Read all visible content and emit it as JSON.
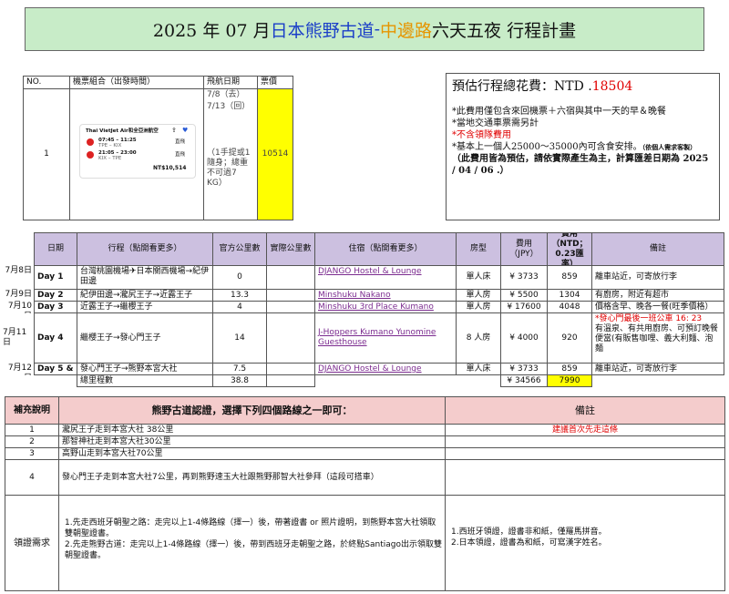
{
  "title": {
    "part1": "2025 年 07 月 ",
    "part2": "日本熊野古道",
    "part3": " - ",
    "part4": "中邊路",
    "part5": " 六天五夜 行程計畫"
  },
  "flight_table": {
    "headers": [
      "NO.",
      "機票組合（出發時間）",
      "飛航日期",
      "票價"
    ],
    "row_no": "1",
    "dates_out": "7/8（去）",
    "dates_back": "7/13（回）",
    "baggage_note": "（1手提或1隨身；總重不可過7 KG）",
    "price": "10514",
    "ticket": {
      "airline": "Thai VietJet Air和全亞洲航空",
      "seg1_time": "07:45 – 11:25",
      "seg1_code": "TPE – KIX",
      "seg1_tag": "直飛",
      "seg2_time": "21:05 – 23:00",
      "seg2_code": "KIX – TPE",
      "seg2_tag": "直飛",
      "total": "NT$10,514"
    }
  },
  "summary": {
    "label": "預估行程總花費：NTD .",
    "amount": "18504",
    "line1": "*此費用僅包含來回機票＋六宿與其中一天的早＆晚餐",
    "line2": "*當地交通車票需另計",
    "line3": "*不含領隊費用",
    "line4": "*基本上一個人25000～35000內可含食安排。",
    "line4_note": "（依個人需求客製）",
    "line5": "（此費用皆為預估，請依實際產生為主，計算匯差日期為 2025 / 04 / 06 .）"
  },
  "itinerary": {
    "headers": [
      "日期",
      "行程（點開看更多）",
      "官方公里數",
      "實際公里數",
      "住宿（點開看更多）",
      "房型",
      "費用（JPY）",
      "費用（NTD；0.23匯率）",
      "備註"
    ],
    "rows": [
      {
        "date": "7月8日",
        "day": "Day 1",
        "route": "台灣桃園機場✈日本關西機場→紀伊田邊",
        "km": "0",
        "real": "",
        "stay": "DJANGO Hostel & Lounge",
        "room": "單人床",
        "jpy": "¥ 3733",
        "ntd": "859",
        "note": "離車站近，可寄放行李",
        "note_red": ""
      },
      {
        "date": "7月9日",
        "day": "Day 2",
        "route": "紀伊田邊→瀧尻王子→近露王子",
        "km": "13.3",
        "real": "",
        "stay": "Minshuku Nakano",
        "room": "單人房",
        "jpy": "¥ 5500",
        "ntd": "1304",
        "note": "有廚房，附近有超市",
        "note_red": ""
      },
      {
        "date": "7月10日",
        "day": "Day 3",
        "route": "近露王子→繼櫻王子",
        "km": "4",
        "real": "",
        "stay": "Minshuku 3rd Place Kumano Kodo",
        "room": "單人房",
        "jpy": "¥ 17600",
        "ntd": "4048",
        "note": "價格含早、晚各一餐(旺季價格）",
        "note_red": ""
      },
      {
        "date": "7月11日",
        "day": "Day 4",
        "route": "繼櫻王子→發心門王子",
        "km": "14",
        "real": "",
        "stay": "J-Hoppers Kumano Yunomine Guesthouse",
        "room": "8 人房",
        "jpy": "¥ 4000",
        "ntd": "920",
        "note": "有溫泉、有共用廚房、可預訂晚餐便當(有販售咖哩、義大利麵、泡麵",
        "note_red": "*發心門最後一班公車 16: 23"
      },
      {
        "date": "7月12日",
        "day": "Day 5 & 6",
        "route": "發心門王子→熊野本宮大社",
        "km": "7.5",
        "real": "",
        "stay": "DJANGO Hostel & Lounge",
        "room": "單人床",
        "jpy": "¥ 3733",
        "ntd": "859",
        "note": "離車站近，可寄放行李",
        "note_red": ""
      }
    ],
    "total_label": "總里程數",
    "total_km": "38.8",
    "total_jpy": "¥ 34566",
    "total_ntd": "7990"
  },
  "cert": {
    "col1": "補充說明",
    "col2": "熊野古道認證，選擇下列四個路線之一即可：",
    "col3": "備註",
    "rows": [
      {
        "no": "1",
        "text": "瀧尻王子走到本宮大社 38公里",
        "note": "建議首次先走這條"
      },
      {
        "no": "2",
        "text": "那智神社走到本宮大社30公里",
        "note": ""
      },
      {
        "no": "3",
        "text": "高野山走到本宮大社70公里",
        "note": ""
      },
      {
        "no": "4",
        "text": "發心門王子走到本宮大社7公里，再到熊野速玉大社跟熊野那智大社參拜（這段可搭車）",
        "note": ""
      }
    ],
    "claim_label": "領證需求",
    "claim_text1": "1.先走西班牙朝聖之路：走完以上1-4條路線（擇一）後，帶著證書 or 照片證明，到熊野本宮大社領取雙朝聖證書。",
    "claim_text2": "2.先走熊野古道：走完以上1-4條路線（擇一）後，帶到西班牙走朝聖之路，於終點Santiago出示領取雙朝聖證書。",
    "claim_note1": "1.西班牙領證，證書非和紙，僅羅馬拼音。",
    "claim_note2": "2.日本領證，證書為和紙，可寫漢字姓名。"
  },
  "colors": {
    "header_green": "#c8ecc8",
    "purple": "#ccc0e0",
    "pink": "#f4cccc",
    "yellow": "#ffff00",
    "blue": "#1a3ec8",
    "orange": "#e69500"
  }
}
